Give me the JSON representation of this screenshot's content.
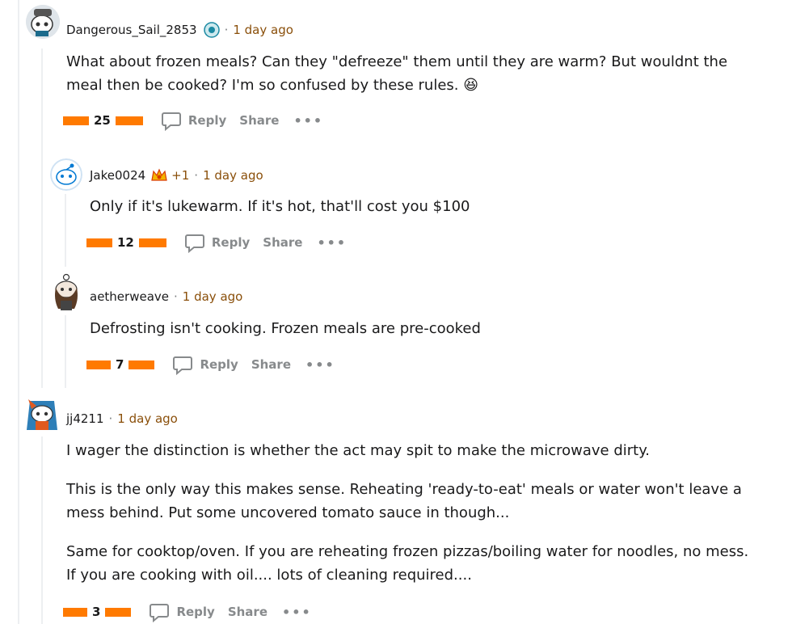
{
  "comments": [
    {
      "username": "Dangerous_Sail_2853",
      "time": "1 day ago",
      "paragraphs": [
        "What about frozen meals? Can they \"defreeze\" them until they are warm? But wouldnt the meal then be cooked? I'm so confused by these rules. 😆"
      ],
      "score": "25",
      "reply_label": "Reply",
      "share_label": "Share",
      "more_label": "•••"
    },
    {
      "username": "Jake0024",
      "flair": "+1",
      "time": "1 day ago",
      "paragraphs": [
        "Only if it's lukewarm. If it's hot, that'll cost you $100"
      ],
      "score": "12",
      "reply_label": "Reply",
      "share_label": "Share",
      "more_label": "•••"
    },
    {
      "username": "aetherweave",
      "time": "1 day ago",
      "paragraphs": [
        "Defrosting isn't cooking. Frozen meals are pre-cooked"
      ],
      "score": "7",
      "reply_label": "Reply",
      "share_label": "Share",
      "more_label": "•••"
    },
    {
      "username": "jj4211",
      "time": "1 day ago",
      "paragraphs": [
        "I wager the distinction is whether the act may spit to make the microwave dirty.",
        "This is the only way this makes sense. Reheating 'ready-to-eat' meals or water won't leave a mess behind. Put some uncovered tomato sauce in though...",
        "Same for cooktop/oven. If you are reheating frozen pizzas/boiling water for noodles, no mess. If you are cooking with oil.... lots of cleaning required...."
      ],
      "score": "3",
      "reply_label": "Reply",
      "share_label": "Share",
      "more_label": "•••"
    }
  ],
  "colors": {
    "vote_bar": "#ff7a00",
    "time": "#8a4f0a",
    "muted": "#878a8c"
  }
}
